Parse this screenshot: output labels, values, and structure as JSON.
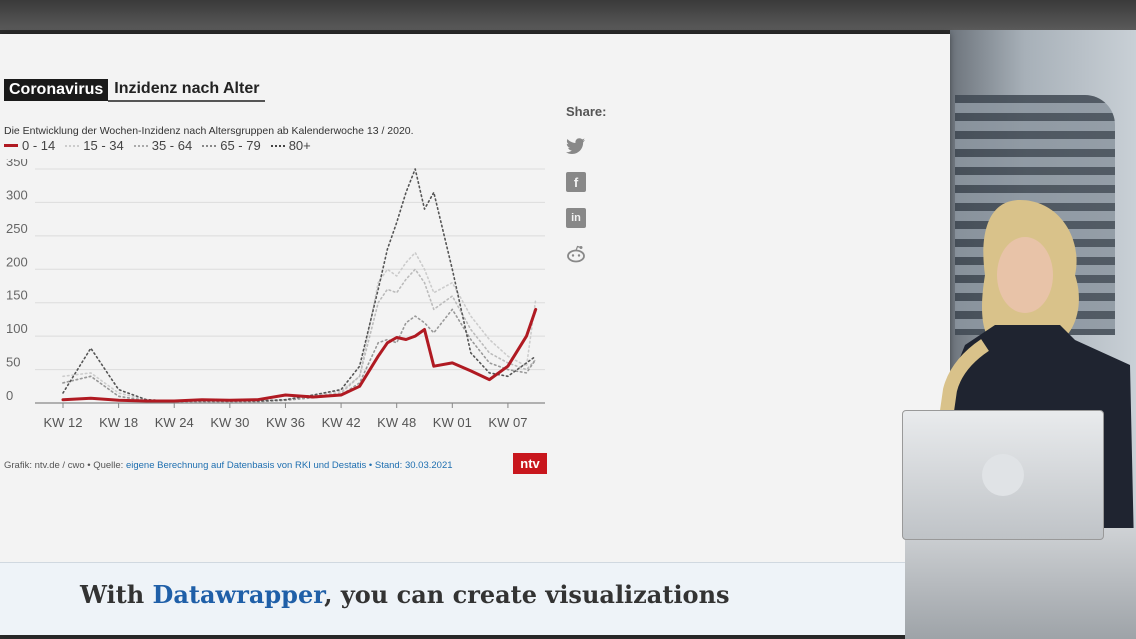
{
  "title_tag": "Coronavirus",
  "title": "Inzidenz nach Alter",
  "subtitle": "Die Entwicklung der Wochen-Inzidenz nach Altersgruppen ab Kalenderwoche 13 / 2020.",
  "legend": [
    "0 - 14",
    "15 - 34",
    "35 - 64",
    "65 - 79",
    "80+"
  ],
  "footer": {
    "prefix": "Grafik: ntv.de / cwo • Quelle: ",
    "source": "eigene Berechnung auf Datenbasis von RKI und Destatis",
    "stand": " • Stand: 30.03.2021"
  },
  "logo": "ntv",
  "share": {
    "label": "Share:",
    "icons": [
      "twitter-icon",
      "facebook-icon",
      "linkedin-icon",
      "reddit-icon"
    ]
  },
  "promo": {
    "prefix": "With ",
    "brand": "Datawrapper",
    "suffix": ", you can create visualizations"
  },
  "colors": {
    "accent": "#b01a22",
    "ntv_red": "#c8161d",
    "link": "#1f6fb0"
  },
  "chart_data": {
    "type": "line",
    "x_ticks": [
      "KW 12",
      "KW 18",
      "KW 24",
      "KW 30",
      "KW 36",
      "KW 42",
      "KW 48",
      "KW 01",
      "KW 07"
    ],
    "ylim": [
      0,
      350
    ],
    "y_ticks": [
      0,
      50,
      100,
      150,
      200,
      250,
      300,
      350
    ],
    "grid": true,
    "series": [
      {
        "name": "0 - 14",
        "style": "solid",
        "color": "#b01a22",
        "x": [
          0,
          3,
          6,
          9,
          12,
          15,
          18,
          21,
          24,
          27,
          30,
          32,
          34,
          35,
          36,
          37,
          38,
          39,
          40,
          42,
          44,
          46,
          48,
          50,
          51
        ],
        "y": [
          5,
          7,
          4,
          3,
          3,
          5,
          4,
          5,
          12,
          9,
          12,
          25,
          70,
          90,
          98,
          95,
          100,
          110,
          55,
          60,
          48,
          35,
          55,
          100,
          140
        ]
      },
      {
        "name": "15 - 34",
        "style": "dotted",
        "color": "#cccccc",
        "x": [
          0,
          3,
          6,
          9,
          12,
          15,
          18,
          21,
          24,
          27,
          30,
          32,
          34,
          35,
          36,
          37,
          38,
          39,
          40,
          42,
          44,
          46,
          48,
          50,
          51
        ],
        "y": [
          40,
          45,
          15,
          5,
          3,
          3,
          3,
          3,
          5,
          12,
          18,
          40,
          180,
          200,
          190,
          210,
          225,
          200,
          165,
          180,
          130,
          95,
          70,
          55,
          155
        ]
      },
      {
        "name": "35 - 64",
        "style": "dotted",
        "color": "#bbbbbb",
        "x": [
          0,
          3,
          6,
          9,
          12,
          15,
          18,
          21,
          24,
          27,
          30,
          32,
          34,
          35,
          36,
          37,
          38,
          39,
          40,
          42,
          44,
          46,
          48,
          50,
          51
        ],
        "y": [
          30,
          40,
          10,
          4,
          3,
          3,
          3,
          3,
          5,
          10,
          15,
          40,
          150,
          170,
          165,
          185,
          200,
          180,
          140,
          160,
          110,
          75,
          60,
          50,
          65
        ]
      },
      {
        "name": "65 - 79",
        "style": "dotted",
        "color": "#999999",
        "x": [
          0,
          3,
          6,
          9,
          12,
          15,
          18,
          21,
          24,
          27,
          30,
          32,
          34,
          35,
          36,
          37,
          38,
          39,
          40,
          42,
          44,
          46,
          48,
          50,
          51
        ],
        "y": [
          30,
          40,
          10,
          3,
          2,
          2,
          2,
          2,
          4,
          8,
          12,
          30,
          90,
          95,
          90,
          120,
          130,
          120,
          105,
          140,
          95,
          60,
          50,
          45,
          65
        ]
      },
      {
        "name": "80+",
        "style": "dotted",
        "color": "#555555",
        "x": [
          0,
          3,
          6,
          9,
          12,
          15,
          18,
          21,
          24,
          27,
          30,
          32,
          34,
          35,
          36,
          37,
          38,
          39,
          40,
          42,
          44,
          46,
          48,
          50,
          51
        ],
        "y": [
          15,
          82,
          20,
          5,
          3,
          3,
          3,
          3,
          5,
          12,
          20,
          55,
          170,
          230,
          270,
          315,
          350,
          290,
          315,
          200,
          75,
          45,
          40,
          60,
          70
        ]
      }
    ]
  }
}
